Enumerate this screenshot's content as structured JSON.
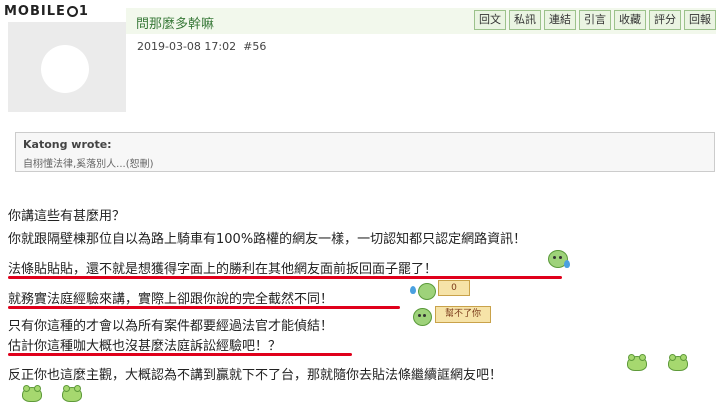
{
  "logo": {
    "left": "MOBILE",
    "right": "1"
  },
  "post": {
    "username": "問那麼多幹嘛",
    "timestamp": "2019-03-08 17:02",
    "post_number": "#56",
    "actions": [
      "回文",
      "私訊",
      "連結",
      "引言",
      "收藏",
      "評分",
      "回報"
    ]
  },
  "quote": {
    "author": "Katong wrote:",
    "text": "自栩懂法律,奚落別人...(恕刪)"
  },
  "body": {
    "lines": [
      "你講這些有甚麼用？",
      "你就跟隔壁棟那位自以為路上騎車有100%路權的網友一樣，一切認知都只認定網路資訊！",
      "法條貼貼貼，還不就是想獲得字面上的勝利在其他網友面前扳回面子罷了！",
      "就務實法庭經驗來講，實際上卻跟你說的完全截然不同！",
      "只有你這種的才會以為所有案件都要經過法官才能偵結！",
      "估計你這種咖大概也沒甚麼法庭訴訟經驗吧！？",
      "反正你也這麼主觀，大概認為不講到贏就下不了台，那就隨你去貼法條繼續誆網友吧！"
    ]
  },
  "emoticons": {
    "sign_1": "0",
    "sign_2": "幫不了你"
  },
  "colors": {
    "underline": "#e0001b",
    "username": "#3a7a3a"
  }
}
